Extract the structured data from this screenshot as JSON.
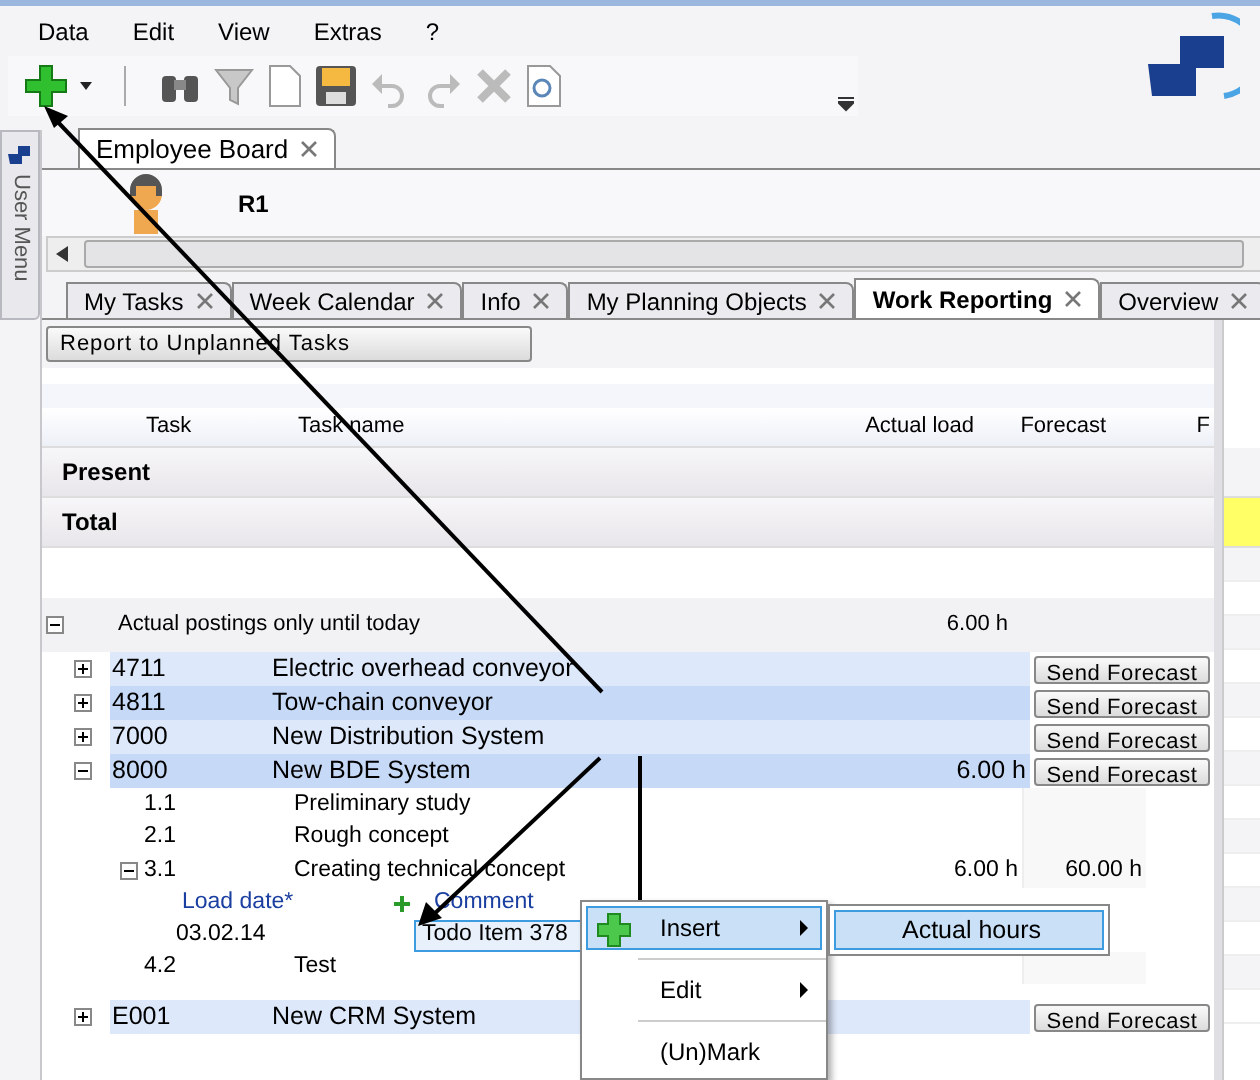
{
  "menu_bar": [
    "Data",
    "Edit",
    "View",
    "Extras",
    "?"
  ],
  "document_tabs": [
    {
      "label": "Employee Board",
      "selected": true
    }
  ],
  "side_tab": {
    "label": "User Menu"
  },
  "employee": {
    "name": "R1"
  },
  "tabs": [
    {
      "label": "My Tasks",
      "selected": false
    },
    {
      "label": "Week Calendar",
      "selected": false
    },
    {
      "label": "Info",
      "selected": false
    },
    {
      "label": "My Planning Objects",
      "selected": false
    },
    {
      "label": "Work Reporting",
      "selected": true
    },
    {
      "label": "Overview",
      "selected": false
    }
  ],
  "report_button": "Report to Unplanned Tasks",
  "columns": [
    "Task",
    "Task name",
    "Actual load",
    "Forecast",
    "F"
  ],
  "summary_rows": [
    {
      "label": "Present",
      "flagged": false
    },
    {
      "label": "Total",
      "flagged": true
    }
  ],
  "group": {
    "label": "Actual postings only until today",
    "actual_load": "6.00 h",
    "expanded": true,
    "children": [
      {
        "task": "4711",
        "name": "Electric overhead conveyor",
        "expanded": false,
        "action": "Send Forecast"
      },
      {
        "task": "4811",
        "name": "Tow-chain conveyor",
        "expanded": false,
        "action": "Send Forecast"
      },
      {
        "task": "7000",
        "name": "New Distribution System",
        "expanded": false,
        "action": "Send Forecast"
      },
      {
        "task": "8000",
        "name": "New BDE System",
        "actual_load": "6.00 h",
        "expanded": true,
        "action": "Send Forecast",
        "children": [
          {
            "task": "1.1",
            "name": "Preliminary study"
          },
          {
            "task": "2.1",
            "name": "Rough concept"
          },
          {
            "task": "3.1",
            "name": "Creating technical concept",
            "actual_load": "6.00 h",
            "forecast": "60.00 h",
            "expanded": true,
            "detail": {
              "headers": [
                "Load date*",
                "Comment"
              ],
              "date": "03.02.14",
              "comment": "Todo Item 378"
            }
          },
          {
            "task": "4.2",
            "name": "Test"
          }
        ]
      },
      {
        "task": "E001",
        "name": "New CRM System",
        "expanded": false,
        "action": "Send Forecast"
      }
    ]
  },
  "context_menu": {
    "items": [
      {
        "label": "Insert",
        "submenu": true,
        "selected": true
      },
      {
        "label": "Edit",
        "submenu": true,
        "selected": false
      },
      {
        "label": "(Un)Mark",
        "submenu": false,
        "selected": false
      }
    ]
  },
  "submenu": {
    "items": [
      {
        "label": "Actual hours",
        "selected": true
      }
    ]
  }
}
